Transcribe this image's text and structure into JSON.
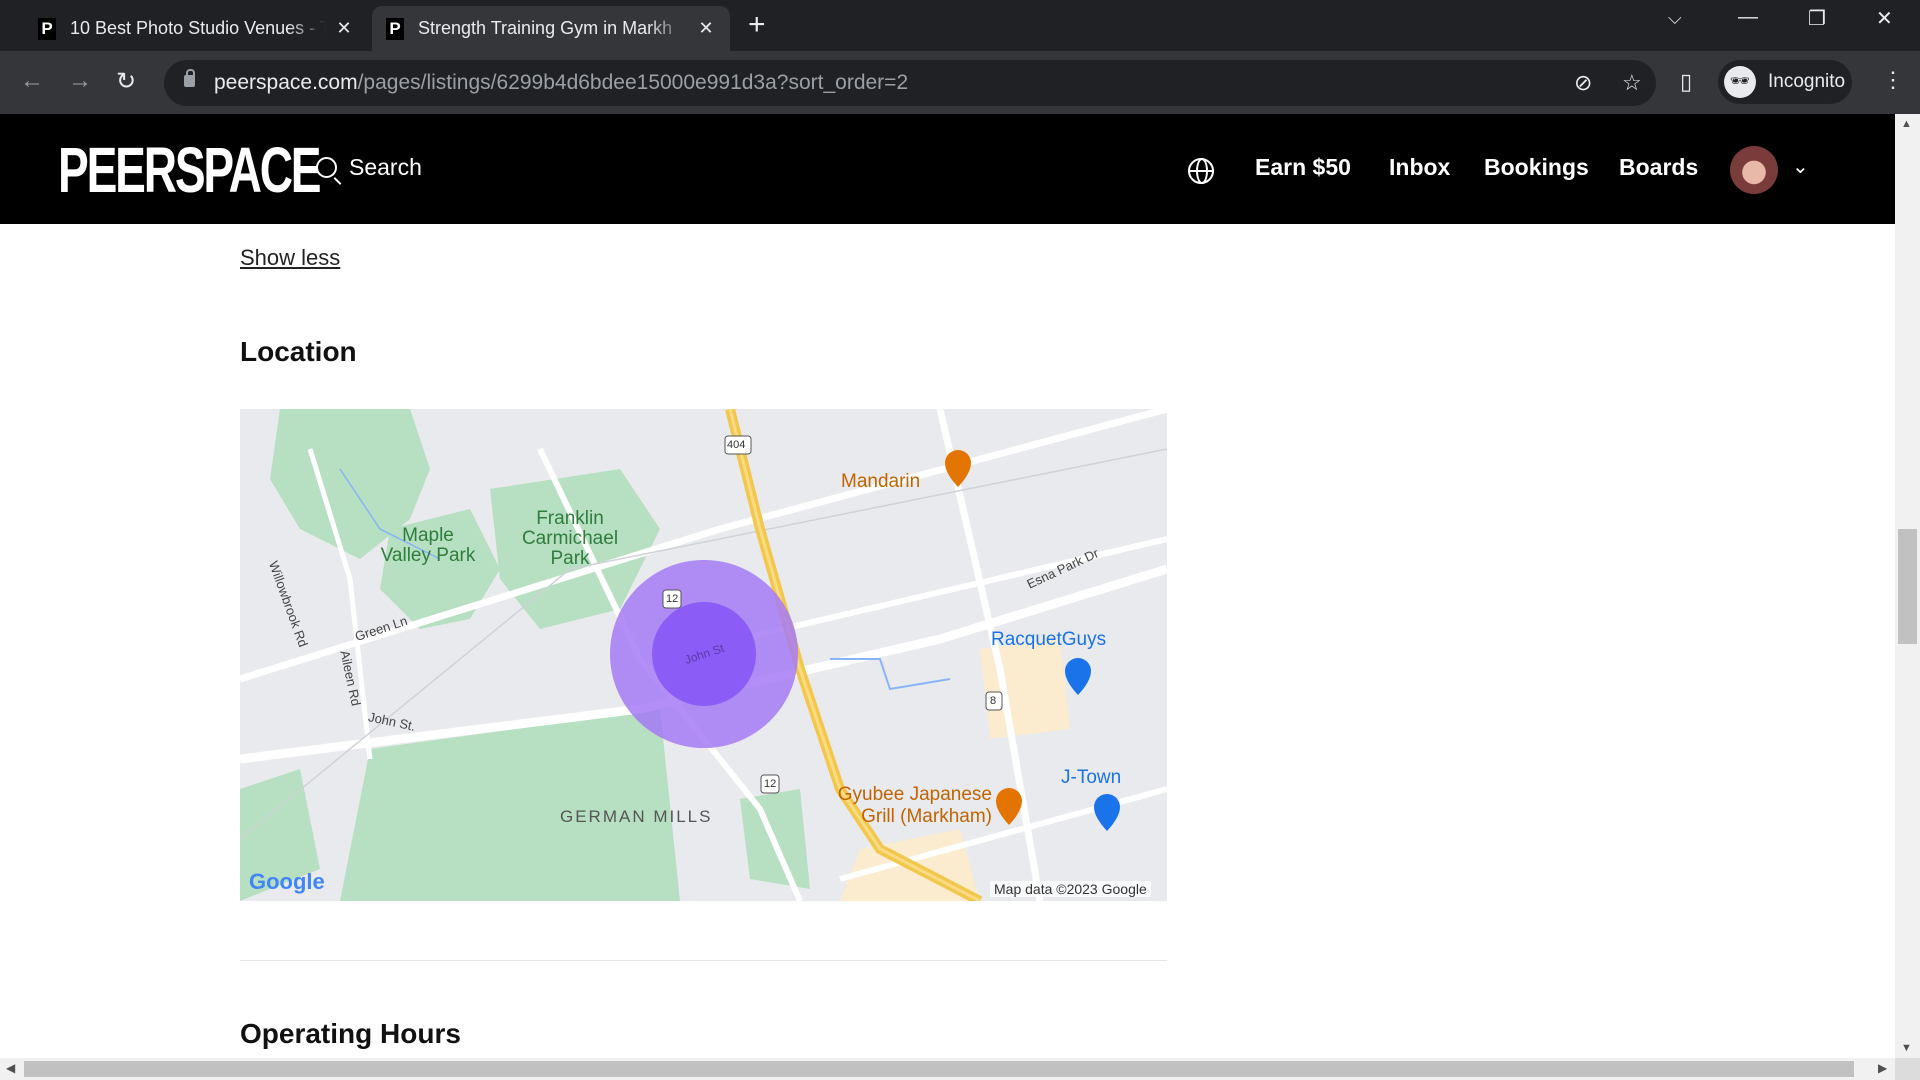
{
  "browser": {
    "tabs": [
      {
        "favicon": "P",
        "title": "10 Best Photo Studio Venues - T",
        "active": false
      },
      {
        "favicon": "P",
        "title": "Strength Training Gym in Markh",
        "active": true
      }
    ],
    "url_host": "peerspace.com",
    "url_path": "/pages/listings/6299b4d6bdee15000e991d3a?sort_order=2",
    "profile_label": "Incognito"
  },
  "site": {
    "logo": "PEERSPACE",
    "search_label": "Search",
    "nav": [
      "Earn $50",
      "Inbox",
      "Bookings",
      "Boards"
    ]
  },
  "content": {
    "show_less": "Show less",
    "location_heading": "Location",
    "operating_hours_heading": "Operating Hours"
  },
  "map": {
    "places": [
      {
        "name": "Mandarin",
        "type": "restaurant",
        "color": "#e37400"
      },
      {
        "name": "RacquetGuys",
        "type": "shopping",
        "color": "#1a73e8"
      },
      {
        "name": "J-Town",
        "type": "shopping",
        "color": "#1a73e8"
      },
      {
        "name": "Gyubee Japanese Grill (Markham)",
        "type": "restaurant",
        "color": "#e37400"
      }
    ],
    "parks": [
      "Maple Valley Park",
      "Franklin Carmichael Park"
    ],
    "neighbourhood": "GERMAN MILLS",
    "streets": [
      "Willowbrook Rd",
      "Green Ln",
      "Aileen Rd",
      "John St.",
      "John St",
      "Esna Park Dr"
    ],
    "route_shields": [
      "404",
      "12",
      "12",
      "8"
    ],
    "attribution": "Map data ©2023 Google",
    "google_logo": "Google",
    "radius_color": "#8b5cf6"
  }
}
